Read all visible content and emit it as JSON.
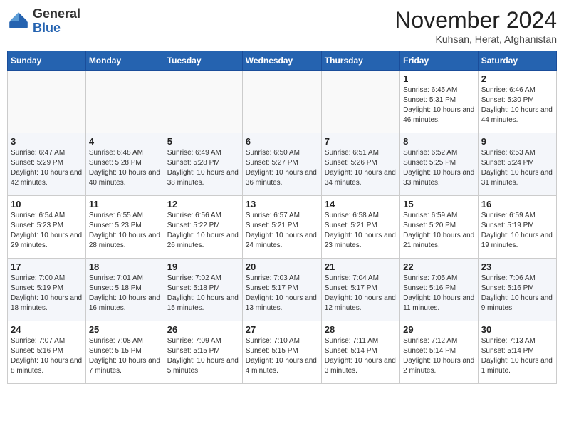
{
  "logo": {
    "general": "General",
    "blue": "Blue"
  },
  "title": "November 2024",
  "location": "Kuhsan, Herat, Afghanistan",
  "days_of_week": [
    "Sunday",
    "Monday",
    "Tuesday",
    "Wednesday",
    "Thursday",
    "Friday",
    "Saturday"
  ],
  "weeks": [
    [
      {
        "day": "",
        "empty": true
      },
      {
        "day": "",
        "empty": true
      },
      {
        "day": "",
        "empty": true
      },
      {
        "day": "",
        "empty": true
      },
      {
        "day": "",
        "empty": true
      },
      {
        "day": "1",
        "sunrise": "6:45 AM",
        "sunset": "5:31 PM",
        "daylight": "10 hours and 46 minutes."
      },
      {
        "day": "2",
        "sunrise": "6:46 AM",
        "sunset": "5:30 PM",
        "daylight": "10 hours and 44 minutes."
      }
    ],
    [
      {
        "day": "3",
        "sunrise": "6:47 AM",
        "sunset": "5:29 PM",
        "daylight": "10 hours and 42 minutes."
      },
      {
        "day": "4",
        "sunrise": "6:48 AM",
        "sunset": "5:28 PM",
        "daylight": "10 hours and 40 minutes."
      },
      {
        "day": "5",
        "sunrise": "6:49 AM",
        "sunset": "5:28 PM",
        "daylight": "10 hours and 38 minutes."
      },
      {
        "day": "6",
        "sunrise": "6:50 AM",
        "sunset": "5:27 PM",
        "daylight": "10 hours and 36 minutes."
      },
      {
        "day": "7",
        "sunrise": "6:51 AM",
        "sunset": "5:26 PM",
        "daylight": "10 hours and 34 minutes."
      },
      {
        "day": "8",
        "sunrise": "6:52 AM",
        "sunset": "5:25 PM",
        "daylight": "10 hours and 33 minutes."
      },
      {
        "day": "9",
        "sunrise": "6:53 AM",
        "sunset": "5:24 PM",
        "daylight": "10 hours and 31 minutes."
      }
    ],
    [
      {
        "day": "10",
        "sunrise": "6:54 AM",
        "sunset": "5:23 PM",
        "daylight": "10 hours and 29 minutes."
      },
      {
        "day": "11",
        "sunrise": "6:55 AM",
        "sunset": "5:23 PM",
        "daylight": "10 hours and 28 minutes."
      },
      {
        "day": "12",
        "sunrise": "6:56 AM",
        "sunset": "5:22 PM",
        "daylight": "10 hours and 26 minutes."
      },
      {
        "day": "13",
        "sunrise": "6:57 AM",
        "sunset": "5:21 PM",
        "daylight": "10 hours and 24 minutes."
      },
      {
        "day": "14",
        "sunrise": "6:58 AM",
        "sunset": "5:21 PM",
        "daylight": "10 hours and 23 minutes."
      },
      {
        "day": "15",
        "sunrise": "6:59 AM",
        "sunset": "5:20 PM",
        "daylight": "10 hours and 21 minutes."
      },
      {
        "day": "16",
        "sunrise": "6:59 AM",
        "sunset": "5:19 PM",
        "daylight": "10 hours and 19 minutes."
      }
    ],
    [
      {
        "day": "17",
        "sunrise": "7:00 AM",
        "sunset": "5:19 PM",
        "daylight": "10 hours and 18 minutes."
      },
      {
        "day": "18",
        "sunrise": "7:01 AM",
        "sunset": "5:18 PM",
        "daylight": "10 hours and 16 minutes."
      },
      {
        "day": "19",
        "sunrise": "7:02 AM",
        "sunset": "5:18 PM",
        "daylight": "10 hours and 15 minutes."
      },
      {
        "day": "20",
        "sunrise": "7:03 AM",
        "sunset": "5:17 PM",
        "daylight": "10 hours and 13 minutes."
      },
      {
        "day": "21",
        "sunrise": "7:04 AM",
        "sunset": "5:17 PM",
        "daylight": "10 hours and 12 minutes."
      },
      {
        "day": "22",
        "sunrise": "7:05 AM",
        "sunset": "5:16 PM",
        "daylight": "10 hours and 11 minutes."
      },
      {
        "day": "23",
        "sunrise": "7:06 AM",
        "sunset": "5:16 PM",
        "daylight": "10 hours and 9 minutes."
      }
    ],
    [
      {
        "day": "24",
        "sunrise": "7:07 AM",
        "sunset": "5:16 PM",
        "daylight": "10 hours and 8 minutes."
      },
      {
        "day": "25",
        "sunrise": "7:08 AM",
        "sunset": "5:15 PM",
        "daylight": "10 hours and 7 minutes."
      },
      {
        "day": "26",
        "sunrise": "7:09 AM",
        "sunset": "5:15 PM",
        "daylight": "10 hours and 5 minutes."
      },
      {
        "day": "27",
        "sunrise": "7:10 AM",
        "sunset": "5:15 PM",
        "daylight": "10 hours and 4 minutes."
      },
      {
        "day": "28",
        "sunrise": "7:11 AM",
        "sunset": "5:14 PM",
        "daylight": "10 hours and 3 minutes."
      },
      {
        "day": "29",
        "sunrise": "7:12 AM",
        "sunset": "5:14 PM",
        "daylight": "10 hours and 2 minutes."
      },
      {
        "day": "30",
        "sunrise": "7:13 AM",
        "sunset": "5:14 PM",
        "daylight": "10 hours and 1 minute."
      }
    ]
  ]
}
